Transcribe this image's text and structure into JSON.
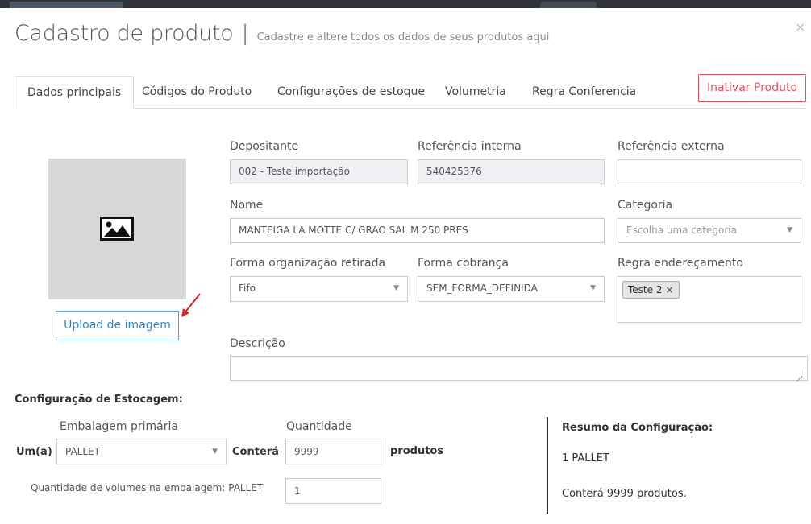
{
  "modal": {
    "title": "Cadastro de produto",
    "separator": "|",
    "subtitle": "Cadastre e altere todos os dados de seus produtos aqui",
    "close_icon": "×"
  },
  "tabs": [
    {
      "label": "Dados principais",
      "active": true
    },
    {
      "label": "Códigos do Produto",
      "active": false
    },
    {
      "label": "Configurações de estoque",
      "active": false
    },
    {
      "label": "Volumetria",
      "active": false
    },
    {
      "label": "Regra Conferencia",
      "active": false
    }
  ],
  "inativar_label": "Inativar Produto",
  "image": {
    "icon": "image-placeholder-icon",
    "upload_label": "Upload de imagem"
  },
  "form": {
    "depositante": {
      "label": "Depositante",
      "value": "002 - Teste importação"
    },
    "ref_interna": {
      "label": "Referência interna",
      "value": "540425376"
    },
    "ref_externa": {
      "label": "Referência externa",
      "value": ""
    },
    "nome": {
      "label": "Nome",
      "value": "MANTEIGA LA MOTTE C/ GRAO SAL M 250 PRES"
    },
    "categoria": {
      "label": "Categoria",
      "placeholder": "Escolha uma categoria"
    },
    "forma_org": {
      "label": "Forma organização retirada",
      "value": "Fifo"
    },
    "forma_cobranca": {
      "label": "Forma cobrança",
      "value": "SEM_FORMA_DEFINIDA"
    },
    "regra_end": {
      "label": "Regra endereçamento",
      "tag": "Teste 2",
      "tag_remove": "×"
    },
    "descricao": {
      "label": "Descrição",
      "value": ""
    }
  },
  "estocagem": {
    "title": "Configuração de Estocagem:",
    "embalagem_label": "Embalagem primária",
    "quantidade_label": "Quantidade",
    "um_label": "Um(a)",
    "embalagem_value": "PALLET",
    "contera_label": "Conterá",
    "quantidade_value": "9999",
    "produtos_label": "produtos",
    "volumes_label": "Quantidade de volumes na embalagem: PALLET",
    "volumes_value": "1"
  },
  "resumo": {
    "title": "Resumo da Configuração:",
    "line1": "1 PALLET",
    "line2": "Conterá 9999 produtos."
  },
  "colors": {
    "danger": "#e4505a",
    "primary": "#2e86c8",
    "arrow": "#e02020"
  }
}
